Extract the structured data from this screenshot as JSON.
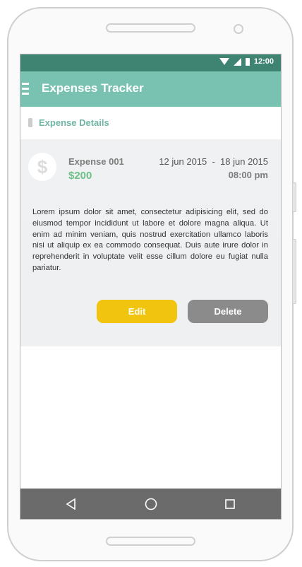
{
  "status_bar": {
    "time": "12:00"
  },
  "app_bar": {
    "title": "Expenses Tracker"
  },
  "section": {
    "title": "Expense Details"
  },
  "expense": {
    "icon_symbol": "$",
    "name": "Expense 001",
    "amount": "$200",
    "date_range": "12 jun 2015  -  18 jun 2015",
    "time": "08:00 pm",
    "description": "Lorem ipsum dolor sit amet, consectetur adipisicing elit, sed do eiusmod tempor incididunt ut labore et dolore magna aliqua. Ut enim ad minim veniam, quis nostrud exercitation ullamco laboris nisi ut aliquip ex ea commodo consequat. Duis aute irure dolor in reprehenderit in voluptate velit esse cillum dolore eu fugiat nulla pariatur."
  },
  "actions": {
    "edit_label": "Edit",
    "delete_label": "Delete"
  },
  "colors": {
    "status_bar": "#3f8473",
    "app_bar": "#79c2b1",
    "accent_text": "#6fb5a4",
    "amount": "#6fbf89",
    "edit_button": "#f1c40f",
    "delete_button": "#8b8b8b",
    "nav_bar": "#6b6b6b"
  },
  "icons": [
    "menu-icon",
    "wifi-icon",
    "signal-icon",
    "battery-icon",
    "dollar-icon",
    "back-icon",
    "home-icon",
    "recent-apps-icon"
  ]
}
